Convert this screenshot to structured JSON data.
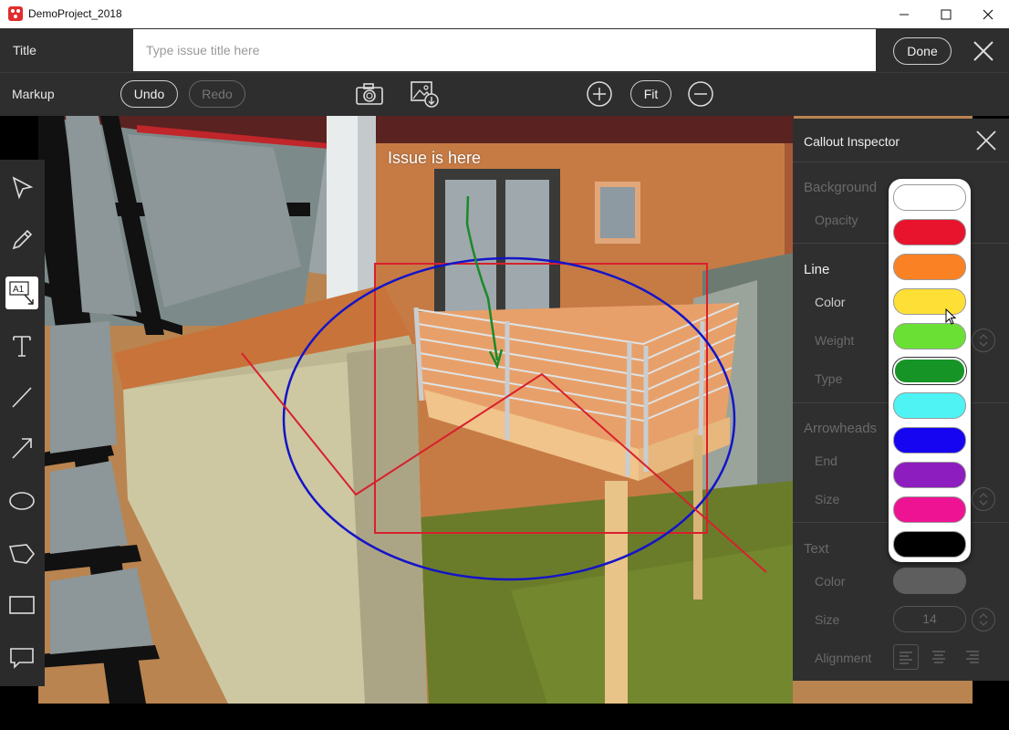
{
  "window": {
    "title": "DemoProject_2018"
  },
  "header": {
    "title_label": "Title",
    "title_placeholder": "Type issue title here",
    "done_label": "Done"
  },
  "markup_bar": {
    "label": "Markup",
    "undo_label": "Undo",
    "redo_label": "Redo",
    "fit_label": "Fit"
  },
  "scene": {
    "annotation_text": "Issue is here",
    "colors": {
      "rectangle": "#d8202e",
      "ellipse": "#1414c8",
      "arrow": "#1a8a2a",
      "polyline": "#d8202e"
    }
  },
  "tools": [
    {
      "name": "select-arrow-icon"
    },
    {
      "name": "pencil-icon"
    },
    {
      "name": "callout-a1-icon"
    },
    {
      "name": "text-icon"
    },
    {
      "name": "line-icon"
    },
    {
      "name": "arrow-icon"
    },
    {
      "name": "ellipse-icon"
    },
    {
      "name": "polygon-icon"
    },
    {
      "name": "rectangle-icon"
    },
    {
      "name": "speech-bubble-icon"
    }
  ],
  "inspector": {
    "title": "Callout Inspector",
    "background": {
      "heading": "Background",
      "opacity_label": "Opacity"
    },
    "line": {
      "heading": "Line",
      "color_label": "Color",
      "weight_label": "Weight",
      "type_label": "Type"
    },
    "arrowheads": {
      "heading": "Arrowheads",
      "end_label": "End",
      "size_label": "Size"
    },
    "text": {
      "heading": "Text",
      "color_label": "Color",
      "size_label": "Size",
      "size_value": "14",
      "alignment_label": "Alignment"
    }
  },
  "palette": {
    "swatches": [
      "#ffffff",
      "#e8132d",
      "#fb8224",
      "#fedf36",
      "#6ae035",
      "#169526",
      "#4ff3f3",
      "#1605f0",
      "#8d1dbe",
      "#ee1393",
      "#000000"
    ],
    "selected_index": 5
  }
}
